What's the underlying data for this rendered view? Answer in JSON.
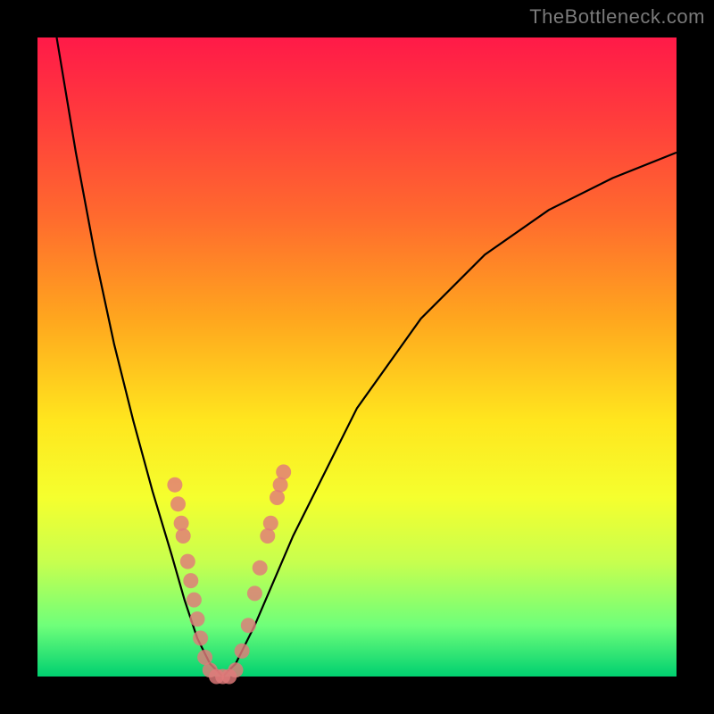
{
  "watermark": "TheBottleneck.com",
  "colors": {
    "frame": "#000000",
    "dot": "#e07a7a",
    "curve": "#000000",
    "gradient_top": "#ff1a48",
    "gradient_bottom": "#00d070"
  },
  "chart_data": {
    "type": "line",
    "title": "",
    "xlabel": "",
    "ylabel": "",
    "xlim": [
      0,
      100
    ],
    "ylim": [
      0,
      100
    ],
    "grid": false,
    "description": "V-shaped bottleneck curve. Y axis = bottleneck percentage (0 at bottom = green/good, 100 at top = red/bad). The curve plunges from top-left, reaches 0 around x≈28, then rises again toward the right. Salmon dots mark sampled/measured hardware combinations clustered near the valley.",
    "series": [
      {
        "name": "bottleneck-curve",
        "x": [
          3,
          6,
          9,
          12,
          15,
          18,
          21,
          23,
          25,
          27,
          29,
          31,
          34,
          40,
          50,
          60,
          70,
          80,
          90,
          100
        ],
        "y": [
          100,
          82,
          66,
          52,
          40,
          29,
          19,
          12,
          6,
          2,
          0,
          2,
          8,
          22,
          42,
          56,
          66,
          73,
          78,
          82
        ]
      }
    ],
    "points": [
      {
        "x": 21.5,
        "y": 30
      },
      {
        "x": 22.0,
        "y": 27
      },
      {
        "x": 22.5,
        "y": 24
      },
      {
        "x": 22.8,
        "y": 22
      },
      {
        "x": 23.5,
        "y": 18
      },
      {
        "x": 24.0,
        "y": 15
      },
      {
        "x": 24.5,
        "y": 12
      },
      {
        "x": 25.0,
        "y": 9
      },
      {
        "x": 25.5,
        "y": 6
      },
      {
        "x": 26.2,
        "y": 3
      },
      {
        "x": 27.0,
        "y": 1
      },
      {
        "x": 28.0,
        "y": 0
      },
      {
        "x": 29.0,
        "y": 0
      },
      {
        "x": 30.0,
        "y": 0
      },
      {
        "x": 31.0,
        "y": 1
      },
      {
        "x": 32.0,
        "y": 4
      },
      {
        "x": 33.0,
        "y": 8
      },
      {
        "x": 34.0,
        "y": 13
      },
      {
        "x": 34.8,
        "y": 17
      },
      {
        "x": 36.0,
        "y": 22
      },
      {
        "x": 36.5,
        "y": 24
      },
      {
        "x": 37.5,
        "y": 28
      },
      {
        "x": 38.0,
        "y": 30
      },
      {
        "x": 38.5,
        "y": 32
      }
    ]
  }
}
